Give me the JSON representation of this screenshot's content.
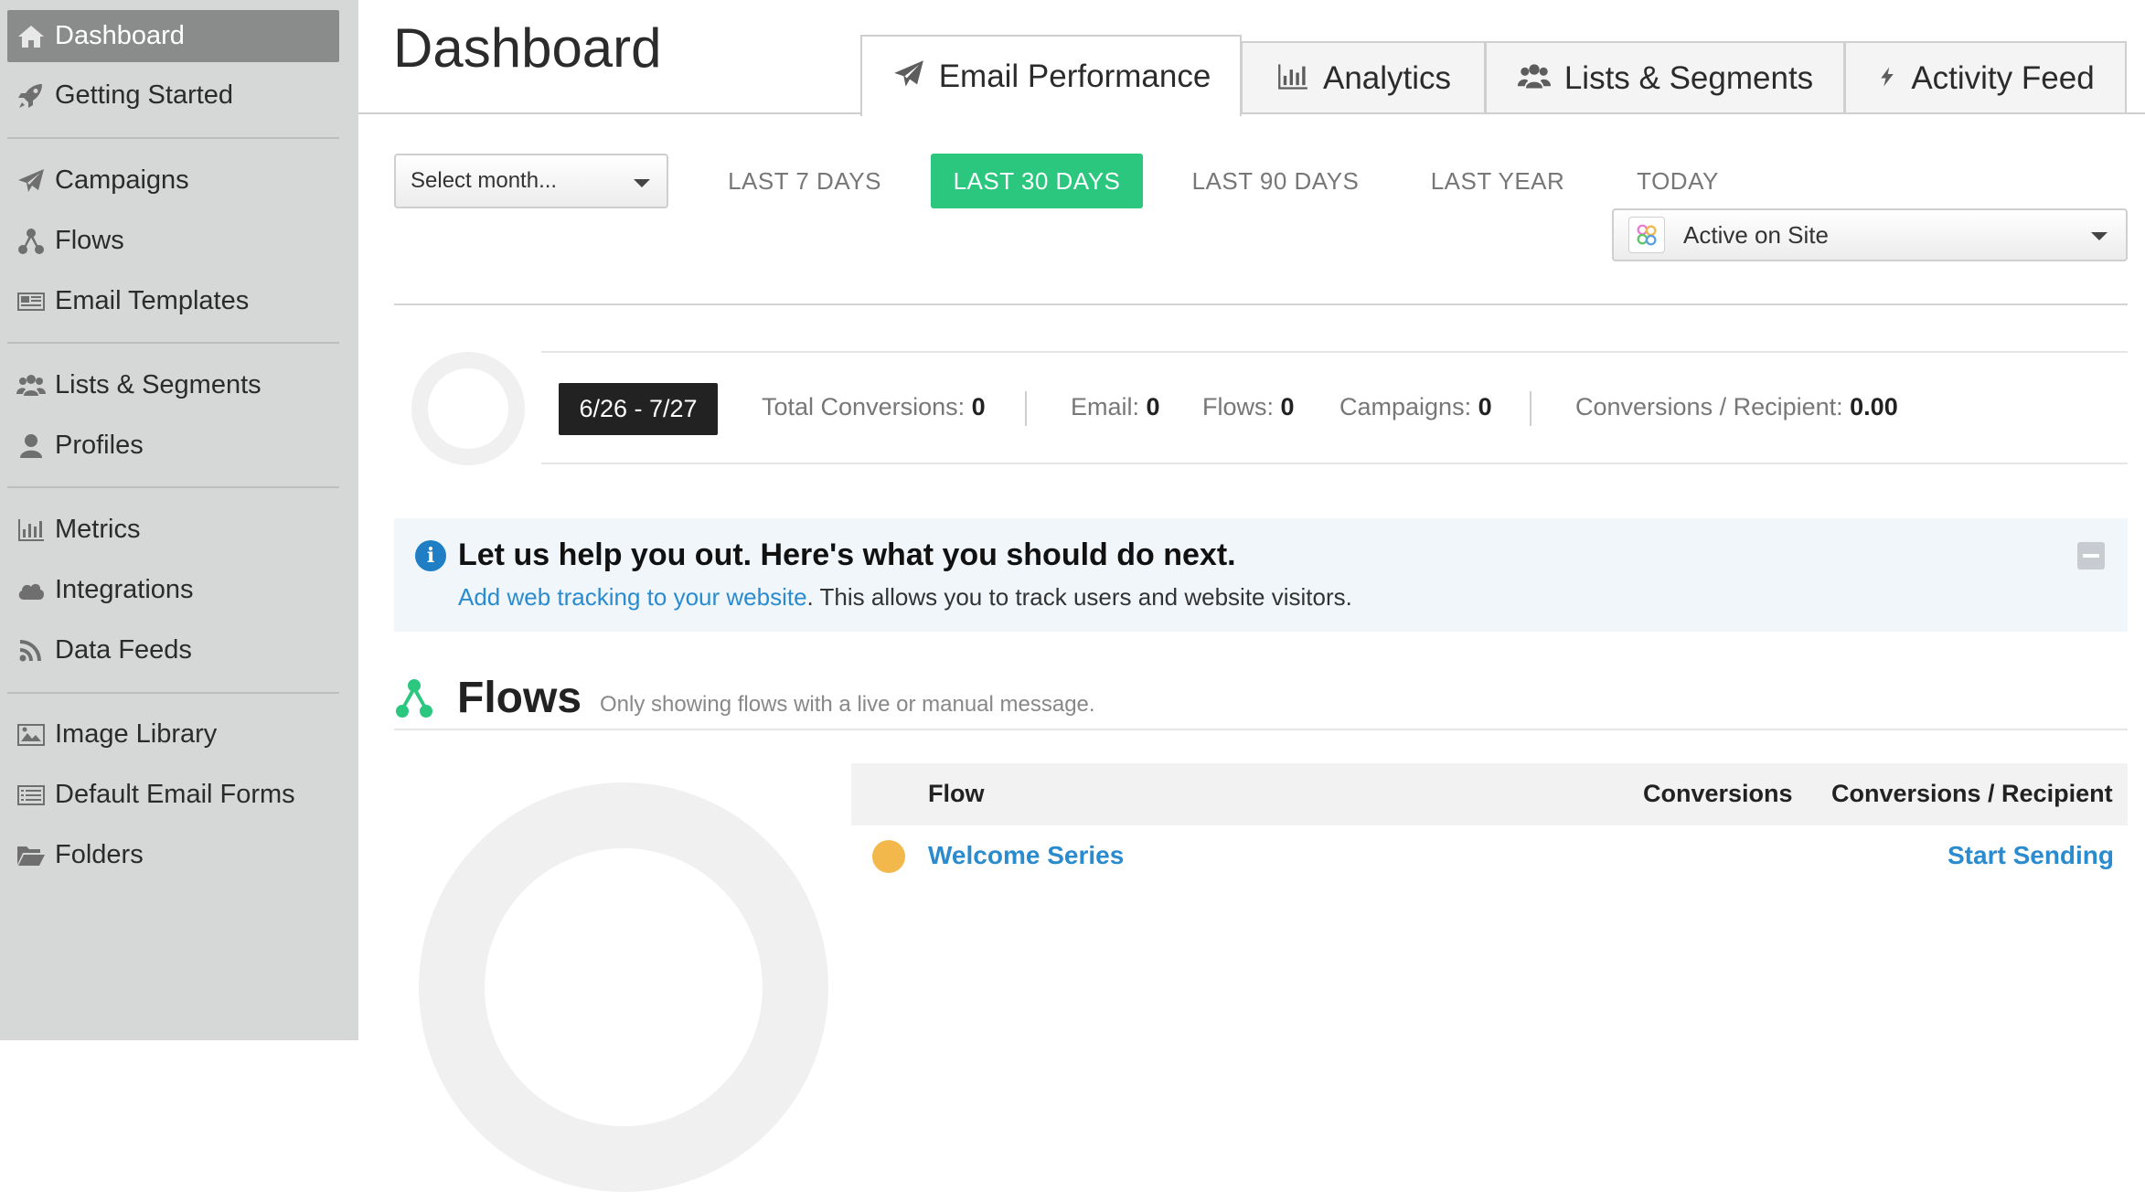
{
  "sidebar": {
    "items": [
      {
        "label": "Dashboard",
        "icon": "home-icon"
      },
      {
        "label": "Getting Started",
        "icon": "rocket-icon"
      },
      {
        "label": "Campaigns",
        "icon": "paper-plane-icon"
      },
      {
        "label": "Flows",
        "icon": "flows-icon"
      },
      {
        "label": "Email Templates",
        "icon": "newspaper-icon"
      },
      {
        "label": "Lists & Segments",
        "icon": "users-icon"
      },
      {
        "label": "Profiles",
        "icon": "user-icon"
      },
      {
        "label": "Metrics",
        "icon": "bar-chart-icon"
      },
      {
        "label": "Integrations",
        "icon": "cloud-icon"
      },
      {
        "label": "Data Feeds",
        "icon": "rss-icon"
      },
      {
        "label": "Image Library",
        "icon": "image-icon"
      },
      {
        "label": "Default Email Forms",
        "icon": "list-icon"
      },
      {
        "label": "Folders",
        "icon": "folder-open-icon"
      }
    ],
    "active_index": 0
  },
  "header": {
    "title": "Dashboard",
    "tabs": [
      {
        "label": "Email Performance",
        "icon": "paper-plane-icon",
        "active": true
      },
      {
        "label": "Analytics",
        "icon": "bar-chart-icon",
        "active": false
      },
      {
        "label": "Lists & Segments",
        "icon": "users-icon",
        "active": false
      },
      {
        "label": "Activity Feed",
        "icon": "bolt-icon",
        "active": false
      }
    ]
  },
  "filters": {
    "month_select": "Select month...",
    "ranges": [
      {
        "label": "LAST 7 DAYS",
        "active": false
      },
      {
        "label": "LAST 30 DAYS",
        "active": true
      },
      {
        "label": "LAST 90 DAYS",
        "active": false
      },
      {
        "label": "LAST YEAR",
        "active": false
      },
      {
        "label": "TODAY",
        "active": false
      }
    ],
    "metric_select": "Active on Site",
    "active_color": "#2bc77e"
  },
  "summary": {
    "date_range": "6/26 - 7/27",
    "total_conversions_label": "Total Conversions:",
    "total_conversions": "0",
    "email_label": "Email:",
    "email": "0",
    "flows_label": "Flows:",
    "flows": "0",
    "campaigns_label": "Campaigns:",
    "campaigns": "0",
    "per_recipient_label": "Conversions / Recipient:",
    "per_recipient": "0.00"
  },
  "help": {
    "title": "Let us help you out. Here's what you should do next.",
    "link_text": "Add web tracking to your website",
    "text": ". This allows you to track users and website visitors."
  },
  "flows_section": {
    "title": "Flows",
    "subtitle": "Only showing flows with a live or manual message.",
    "columns": [
      "Flow",
      "Conversions",
      "Conversions / Recipient"
    ],
    "rows": [
      {
        "name": "Welcome Series",
        "status_color": "#f2b84b",
        "action": "Start Sending"
      }
    ]
  }
}
